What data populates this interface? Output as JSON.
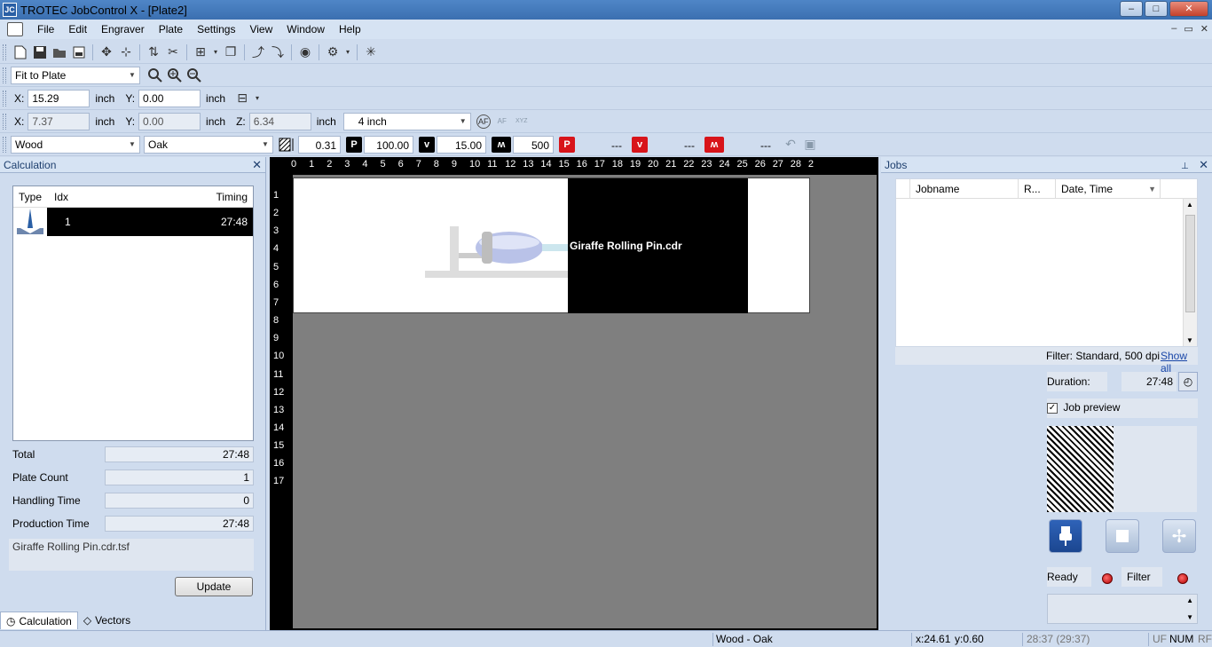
{
  "window": {
    "title": "TROTEC JobControl X - [Plate2]",
    "app_icon": "JC",
    "controls": {
      "minimize": "–",
      "maximize": "□",
      "close": "✕"
    }
  },
  "menu": {
    "items": [
      "File",
      "Edit",
      "Engraver",
      "Plate",
      "Settings",
      "View",
      "Window",
      "Help"
    ],
    "mdi": {
      "minimize": "–",
      "restore": "▭",
      "close": "✕"
    }
  },
  "zoom": {
    "value": "Fit to Plate"
  },
  "position": {
    "x_label": "X:",
    "x_value": "15.29",
    "x_unit": "inch",
    "y_label": "Y:",
    "y_value": "0.00",
    "y_unit": "inch"
  },
  "focus": {
    "x_label": "X:",
    "x_value": "7.37",
    "x_unit": "inch",
    "y_label": "Y:",
    "y_value": "0.00",
    "y_unit": "inch",
    "z_label": "Z:",
    "z_value": "6.34",
    "z_unit": "inch",
    "lens": "4 inch",
    "af_label": "AF",
    "xyz_label": "XYZ"
  },
  "material": {
    "group": "Wood",
    "name": "Oak",
    "thickness": "0.31",
    "power_label": "P",
    "power": "100.00",
    "speed_label": "v",
    "speed": "15.00",
    "ppi": "500",
    "vector_power_label": "P",
    "vector_power": "---",
    "vector_speed_label": "v",
    "vector_speed": "---",
    "vector_freq": "---"
  },
  "calculation": {
    "title": "Calculation",
    "columns": {
      "type": "Type",
      "idx": "Idx",
      "timing": "Timing"
    },
    "rows": [
      {
        "idx": "1",
        "timing": "27:48"
      }
    ],
    "total_label": "Total",
    "total": "27:48",
    "plate_count_label": "Plate Count",
    "plate_count": "1",
    "handling_label": "Handling Time",
    "handling": "0",
    "production_label": "Production Time",
    "production": "27:48",
    "file": "Giraffe Rolling Pin.cdr.tsf",
    "update_label": "Update",
    "tabs": [
      "Calculation",
      "Vectors"
    ]
  },
  "workspace": {
    "ruler_top": [
      "0",
      "1",
      "2",
      "3",
      "4",
      "5",
      "6",
      "7",
      "8",
      "9",
      "10",
      "11",
      "12",
      "13",
      "14",
      "15",
      "16",
      "17",
      "18",
      "19",
      "20",
      "21",
      "22",
      "23",
      "24",
      "25",
      "26",
      "27",
      "28",
      "2"
    ],
    "ruler_left": [
      "1",
      "2",
      "3",
      "4",
      "5",
      "6",
      "7",
      "8",
      "9",
      "10",
      "11",
      "12",
      "13",
      "14",
      "15",
      "16",
      "17"
    ],
    "job_name": "Giraffe Rolling Pin.cdr"
  },
  "jobs": {
    "title": "Jobs",
    "columns": {
      "jobname": "Jobname",
      "r": "R...",
      "date": "Date, Time"
    },
    "filter_text": "Filter: Standard, 500 dpi",
    "show_all": "Show all",
    "duration_label": "Duration:",
    "duration": "27:48",
    "job_preview_label": "Job preview",
    "job_preview_checked": "✓",
    "ready_label": "Ready",
    "filter_label": "Filter"
  },
  "status": {
    "material": "Wood - Oak",
    "coords_x": "x:24.61",
    "coords_y": "y:0.60",
    "time": "28:37 (29:37)",
    "uf": "UF",
    "num": "NUM",
    "rf": "RF"
  }
}
